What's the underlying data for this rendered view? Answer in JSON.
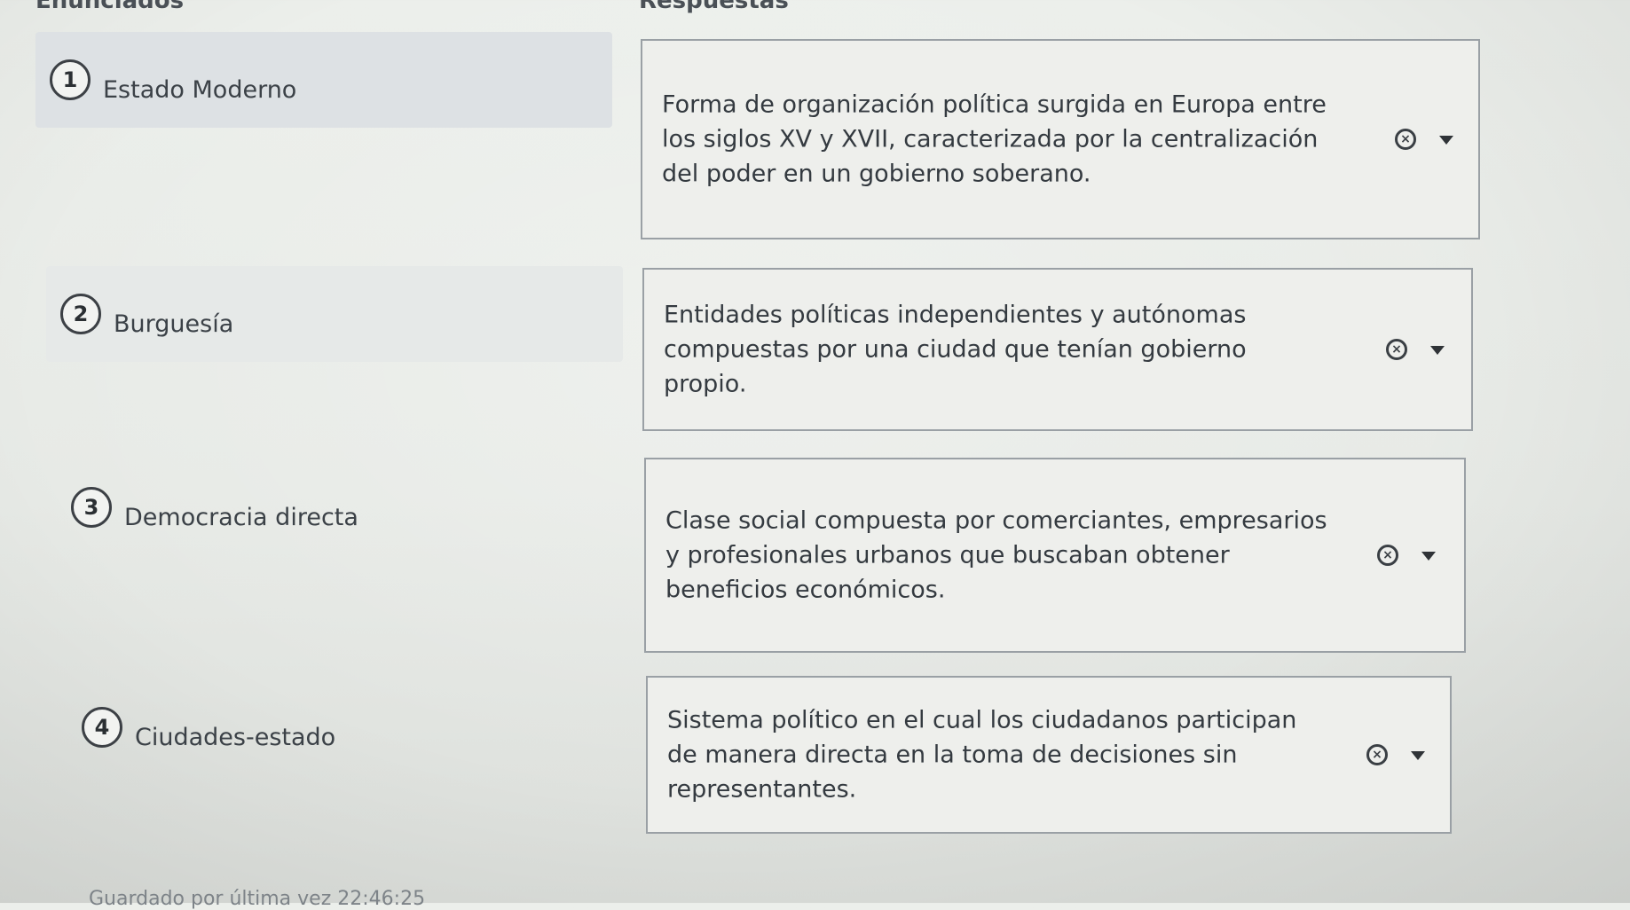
{
  "headers": {
    "left": "Enunciados",
    "right": "Respuestas"
  },
  "terms": [
    {
      "number": "1",
      "label": "Estado Moderno"
    },
    {
      "number": "2",
      "label": "Burguesía"
    },
    {
      "number": "3",
      "label": "Democracia directa"
    },
    {
      "number": "4",
      "label": "Ciudades-estado"
    }
  ],
  "answers": [
    {
      "text": "Forma de organización política surgida en Europa entre los siglos XV y XVII, caracterizada por la centralización del poder en un gobierno soberano.",
      "clear_icon": "clear-circle-x-icon",
      "dropdown_icon": "caret-down-icon"
    },
    {
      "text": "Entidades políticas independientes y autónomas compuestas por una ciudad que tenían gobierno propio.",
      "clear_icon": "clear-circle-x-icon",
      "dropdown_icon": "caret-down-icon"
    },
    {
      "text": "Clase social compuesta por comerciantes, empresarios y profesionales urbanos que buscaban obtener beneficios económicos.",
      "clear_icon": "clear-circle-x-icon",
      "dropdown_icon": "caret-down-icon"
    },
    {
      "text": "Sistema político en el cual los ciudadanos participan de manera directa en la toma de decisiones sin representantes.",
      "clear_icon": "clear-circle-x-icon",
      "dropdown_icon": "caret-down-icon"
    }
  ],
  "footer": {
    "status": "Guardado por última vez 22:46:25"
  }
}
